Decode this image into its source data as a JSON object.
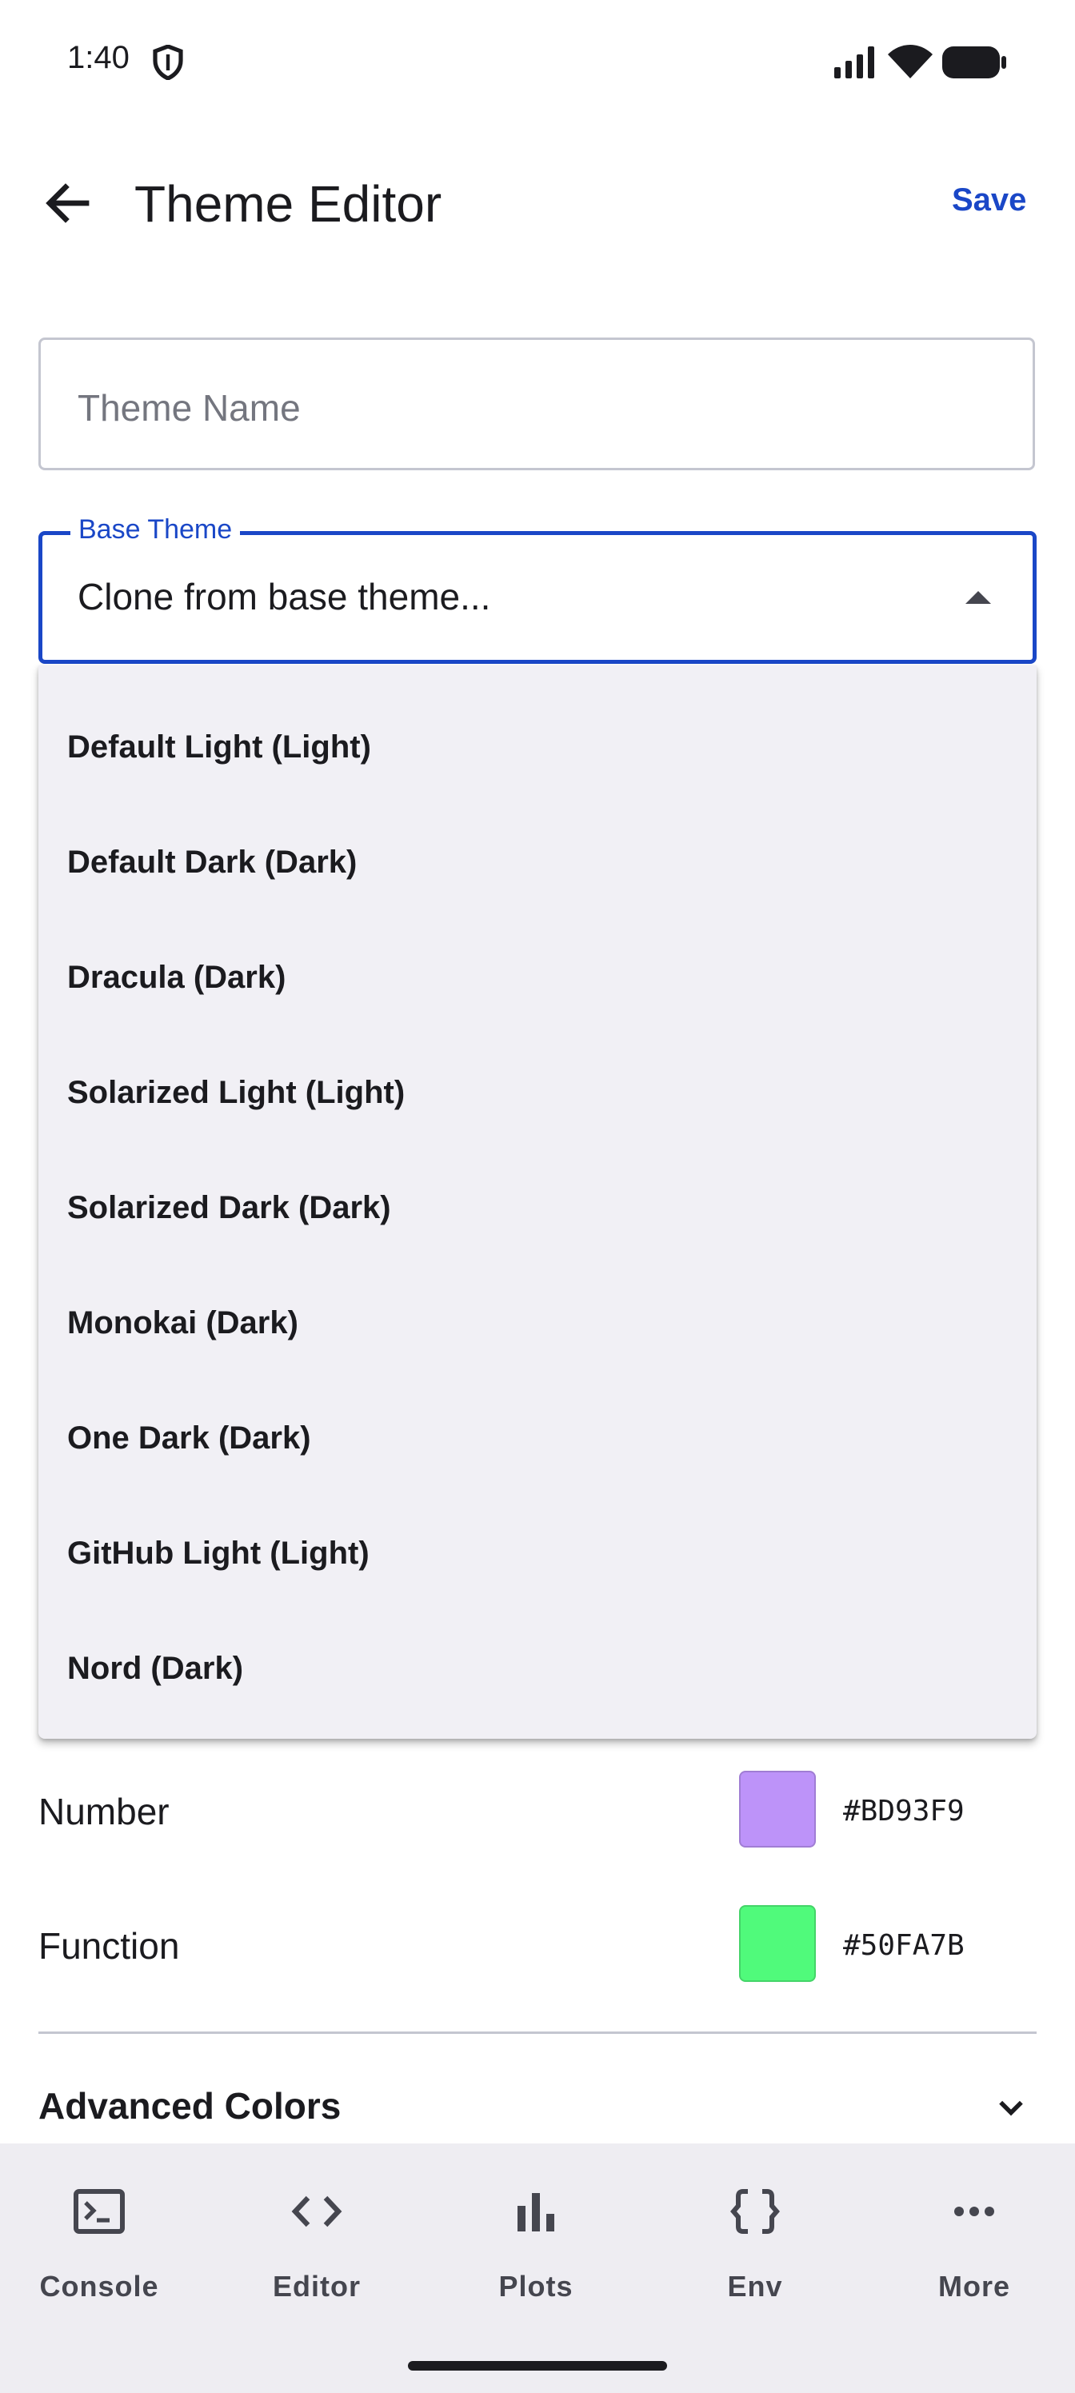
{
  "status_bar": {
    "time": "1:40"
  },
  "app_bar": {
    "title": "Theme Editor",
    "save_label": "Save"
  },
  "theme_name": {
    "placeholder": "Theme Name",
    "value": ""
  },
  "base_theme": {
    "label": "Base Theme",
    "value": "Clone from base theme...",
    "options": [
      "Default Light (Light)",
      "Default Dark (Dark)",
      "Dracula (Dark)",
      "Solarized Light (Light)",
      "Solarized Dark (Dark)",
      "Monokai (Dark)",
      "One Dark (Dark)",
      "GitHub Light (Light)",
      "Nord (Dark)"
    ]
  },
  "colors": [
    {
      "label": "Number",
      "hex": "#BD93F9"
    },
    {
      "label": "Function",
      "hex": "#50FA7B"
    }
  ],
  "advanced": {
    "title": "Advanced Colors"
  },
  "bottom_nav": [
    {
      "label": "Console",
      "icon": "console-icon"
    },
    {
      "label": "Editor",
      "icon": "code-icon"
    },
    {
      "label": "Plots",
      "icon": "bar-chart-icon"
    },
    {
      "label": "Env",
      "icon": "braces-icon"
    },
    {
      "label": "More",
      "icon": "more-icon"
    }
  ],
  "accent_color": "#1A47C7"
}
